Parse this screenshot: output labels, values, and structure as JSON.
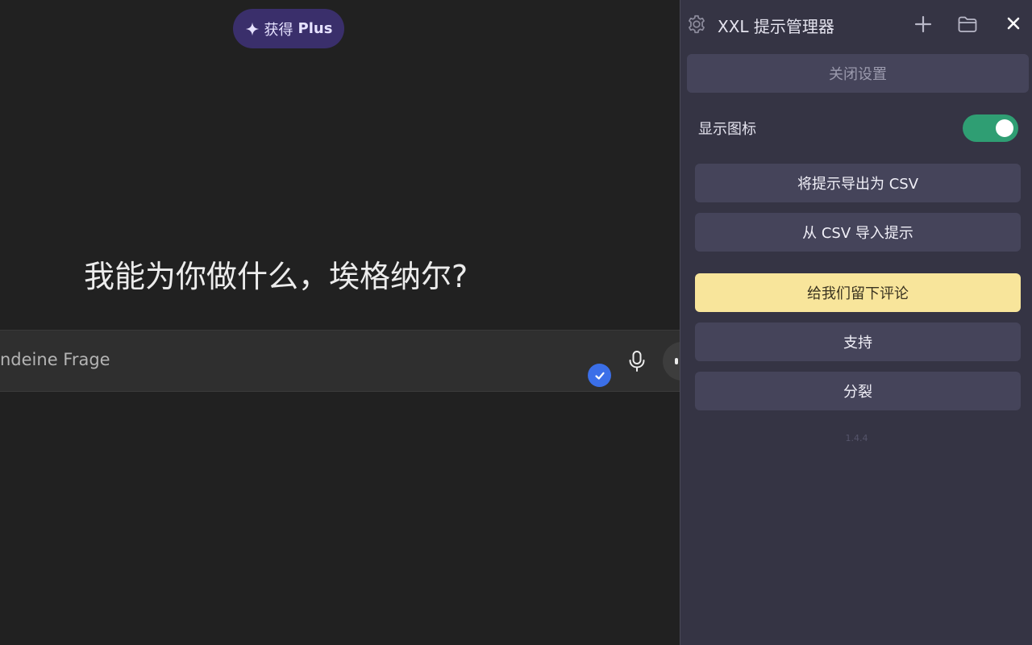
{
  "main": {
    "plus_label": "获得",
    "plus_bold": "Plus",
    "greeting": "我能为你做什么，埃格纳尔?",
    "input_placeholder": "ndeine Frage"
  },
  "panel": {
    "title": "XXL 提示管理器",
    "close_settings": "关闭设置",
    "show_icon_label": "显示图标",
    "show_icon_enabled": true,
    "buttons": {
      "export_csv": "将提示导出为 CSV",
      "import_csv": "从 CSV 导入提示",
      "review": "给我们留下评论",
      "support": "支持",
      "discord": "分裂"
    },
    "version": "1.4.4"
  },
  "colors": {
    "background": "#212121",
    "panel": "#353444",
    "accent_toggle": "#2f9e73",
    "review_button": "#f8e59b",
    "check_badge": "#3b6fe8"
  },
  "icons": {
    "plus_button": "sparkle-icon",
    "header_left": "gear-icon",
    "header_add": "plus-icon",
    "header_folder": "folder-icon",
    "header_close": "close-icon",
    "input_badge": "check-icon",
    "input_mic": "microphone-icon"
  }
}
